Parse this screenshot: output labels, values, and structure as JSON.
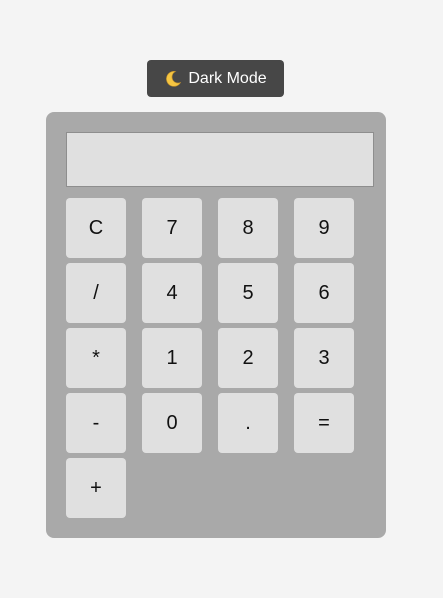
{
  "theme_toggle": {
    "icon": "crescent-moon-icon",
    "label": "Dark Mode"
  },
  "calculator": {
    "display_value": "",
    "keys": [
      "C",
      "7",
      "8",
      "9",
      "/",
      "4",
      "5",
      "6",
      "*",
      "1",
      "2",
      "3",
      "-",
      "0",
      ".",
      "=",
      "+"
    ]
  },
  "colors": {
    "page_bg": "#f4f4f4",
    "toggle_bg": "#474747",
    "calc_bg": "#a9a9a9",
    "key_bg": "#e0e0e0",
    "moon": "#f5c542"
  }
}
